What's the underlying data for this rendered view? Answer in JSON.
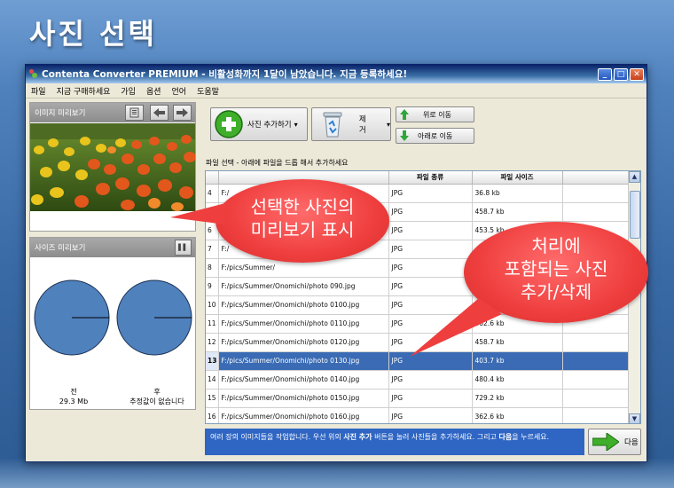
{
  "page": {
    "title": "사진 선택"
  },
  "window": {
    "title": "Contenta Converter PREMIUM - 비활성화까지 1달이 남았습니다. 지금 등록하세요!",
    "minimize": "_",
    "maximize": "□",
    "close": "✕"
  },
  "menu": [
    "파일",
    "지금 구매하세요",
    "가입",
    "옵션",
    "언어",
    "도움말"
  ],
  "left": {
    "image_preview_label": "이미지 미리보기",
    "size_preview_label": "사이즈 미리보기",
    "pause_symbol": "▌▌",
    "before_label": "전",
    "before_value": "29.3 Mb",
    "after_label": "후",
    "after_value": "추정값이 없습니다"
  },
  "toolbar": {
    "add_label": "사진 추가하기",
    "remove_label": "제거",
    "move_up_label": "위로 이동",
    "move_down_label": "아래로 이동",
    "dropdown_arrow": "▾"
  },
  "hint": "파일 선택 - 아래에 파일을 드롭 해서 추가하세요",
  "table": {
    "columns": [
      "",
      "",
      "파일 종류",
      "파일 사이즈"
    ],
    "rows": [
      {
        "num": "4",
        "path": "F:/",
        "type": "JPG",
        "size": "36.8 kb"
      },
      {
        "num": "5",
        "path": "F:/",
        "type": "JPG",
        "size": "458.7 kb"
      },
      {
        "num": "6",
        "path": "F:/",
        "type": "JPG",
        "size": "453.5 kb"
      },
      {
        "num": "7",
        "path": "F:/",
        "type": "JPG",
        "size": ""
      },
      {
        "num": "8",
        "path": "F:/pics/Summer/",
        "type": "JPG",
        "size": ""
      },
      {
        "num": "9",
        "path": "F:/pics/Summer/Onomichi/photo 090.jpg",
        "type": "JPG",
        "size": ""
      },
      {
        "num": "10",
        "path": "F:/pics/Summer/Onomichi/photo 0100.jpg",
        "type": "JPG",
        "size": ""
      },
      {
        "num": "11",
        "path": "F:/pics/Summer/Onomichi/photo 0110.jpg",
        "type": "JPG",
        "size": "362.6 kb"
      },
      {
        "num": "12",
        "path": "F:/pics/Summer/Onomichi/photo 0120.jpg",
        "type": "JPG",
        "size": "458.7 kb"
      },
      {
        "num": "13",
        "path": "F:/pics/Summer/Onomichi/photo 0130.jpg",
        "type": "JPG",
        "size": "403.7 kb",
        "selected": true
      },
      {
        "num": "14",
        "path": "F:/pics/Summer/Onomichi/photo 0140.jpg",
        "type": "JPG",
        "size": "480.4 kb"
      },
      {
        "num": "15",
        "path": "F:/pics/Summer/Onomichi/photo 0150.jpg",
        "type": "JPG",
        "size": "729.2 kb"
      },
      {
        "num": "16",
        "path": "F:/pics/Summer/Onomichi/photo 0160.jpg",
        "type": "JPG",
        "size": "362.6 kb"
      }
    ]
  },
  "info": {
    "text_1": "여러 장의 이미지들을 작업합니다. 우선 위의",
    "bold_1": "사진 추가",
    "text_2": "버튼을 눌러 사진들을 추가하세요. 그리고",
    "bold_2": "다음",
    "text_3": "을 누르세요."
  },
  "next_label": "다음",
  "callouts": {
    "preview_line1": "선택한 사진의",
    "preview_line2": "미리보기 표시",
    "process_line1": "처리에",
    "process_line2": "포함되는 사진",
    "process_line3": "추가/삭제"
  },
  "colors": {
    "selection": "#3a6bb4",
    "callout": "#ef3e3e",
    "info_bar": "#2f66c4"
  }
}
